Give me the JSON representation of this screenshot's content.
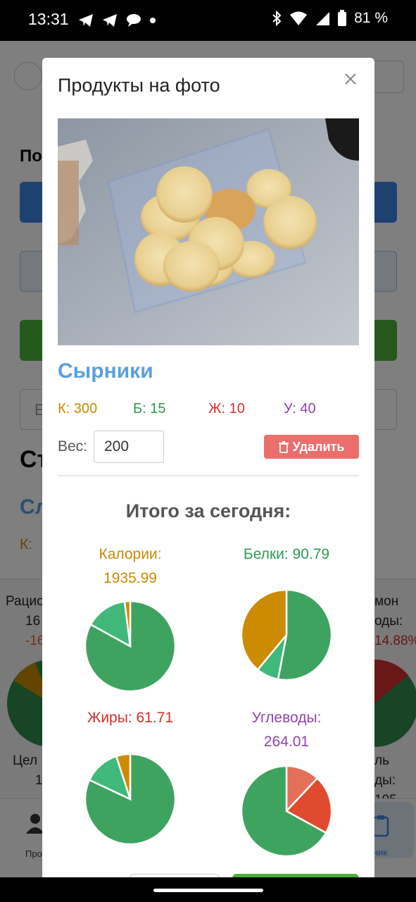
{
  "status_bar": {
    "time": "13:31",
    "icons": [
      "telegram-icon",
      "telegram-icon",
      "chat-icon",
      "dot-icon"
    ],
    "right_icons": [
      "bluetooth-icon",
      "wifi-icon",
      "signal-icon",
      "battery-icon"
    ],
    "battery": "81 %"
  },
  "background": {
    "nav_tab_left": "Про",
    "nav_tab_right": "ник",
    "left_card": {
      "line1": "Рацио",
      "line2": "16",
      "line3": "-16",
      "line4": "Цел",
      "line5": "1"
    },
    "right_card": {
      "line1": "мон",
      "line2": "оды:",
      "line3": "14.88%",
      "line4": "ль",
      "line5": "ды: 195"
    },
    "page_text": {
      "a": "По",
      "b": "Ст",
      "c": "Сл",
      "d": "К:",
      "e": "Е"
    }
  },
  "modal": {
    "title": "Продукты на фото",
    "product": {
      "name": "Сырники",
      "calories": "К: 300",
      "protein": "Б: 15",
      "fat": "Ж: 10",
      "carbs": "У: 40",
      "weight_label": "Вес:",
      "weight_value": "200",
      "delete_label": "Удалить"
    },
    "totals_title": "Итого за сегодня:",
    "charts": [
      {
        "label_line1": "Калории:",
        "label_line2": "1935.99",
        "color": "#c88a00"
      },
      {
        "label_line1": "Белки: 90.79",
        "label_line2": "",
        "color": "#3aa05a"
      },
      {
        "label_line1": "Жиры: 61.71",
        "label_line2": "",
        "color": "#d0312d"
      },
      {
        "label_line1": "Углеводы:",
        "label_line2": "264.01",
        "color": "#8e44ad"
      }
    ]
  },
  "chart_data": [
    {
      "type": "pie",
      "slices": [
        {
          "value": 0.83,
          "color": "#3fa360"
        },
        {
          "value": 0.15,
          "color": "#3fb87a"
        },
        {
          "value": 0.02,
          "color": "#cc8b00"
        }
      ]
    },
    {
      "type": "pie",
      "slices": [
        {
          "value": 0.53,
          "color": "#3fa360"
        },
        {
          "value": 0.08,
          "color": "#3fb87a"
        },
        {
          "value": 0.39,
          "color": "#cc8b00"
        }
      ]
    },
    {
      "type": "pie",
      "slices": [
        {
          "value": 0.82,
          "color": "#3fa360"
        },
        {
          "value": 0.13,
          "color": "#3fb87a"
        },
        {
          "value": 0.05,
          "color": "#cc8b00"
        }
      ]
    },
    {
      "type": "pie",
      "slices": [
        {
          "value": 0.12,
          "color": "#e3705a"
        },
        {
          "value": 0.21,
          "color": "#e04a2e"
        },
        {
          "value": 0.67,
          "color": "#3fa360"
        }
      ]
    }
  ]
}
